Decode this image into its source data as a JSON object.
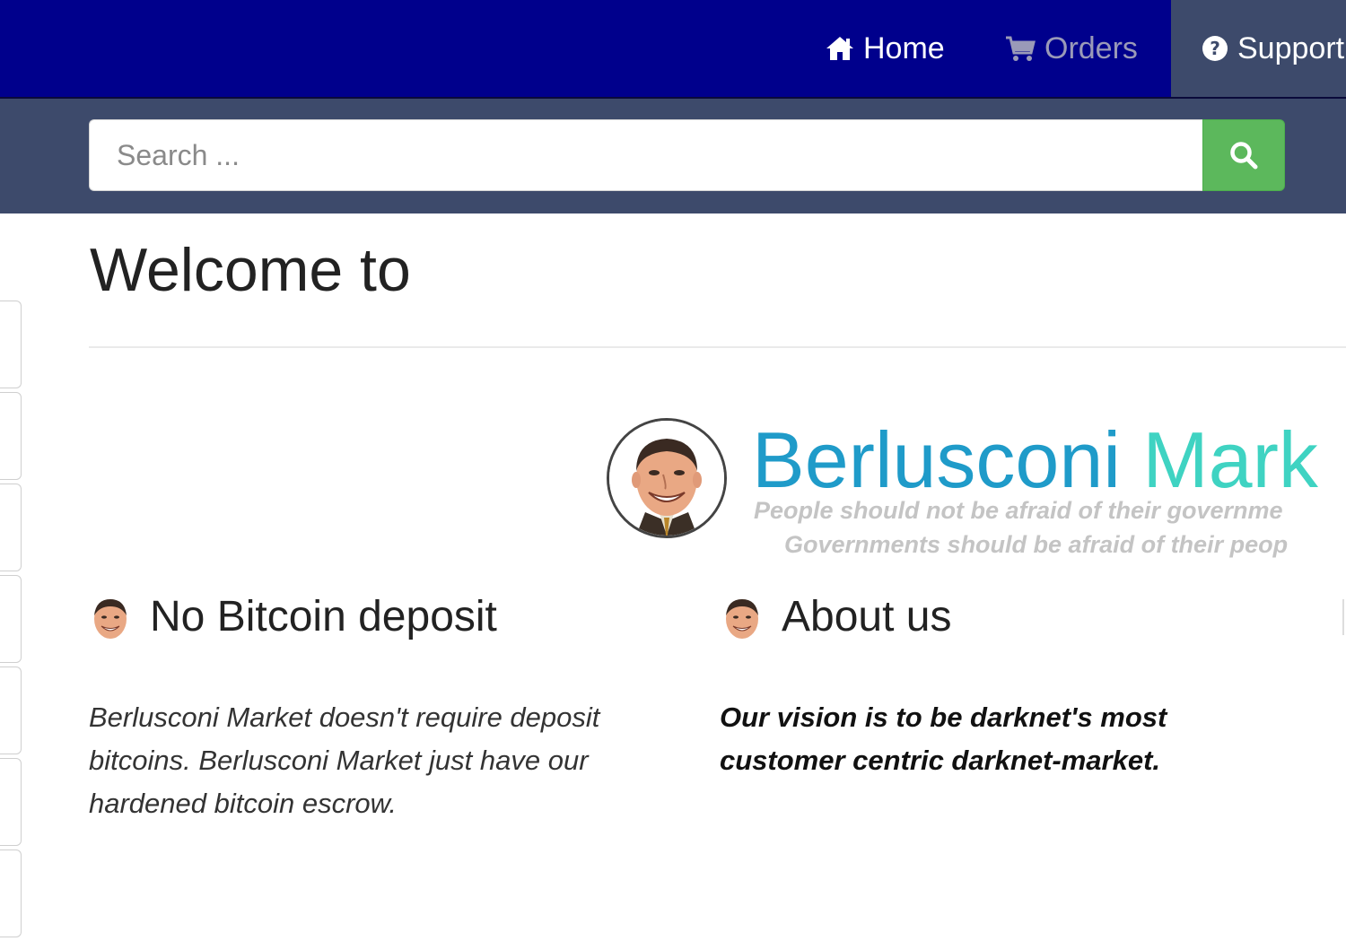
{
  "nav": {
    "home_label": "Home",
    "orders_label": "Orders",
    "support_label": "Support",
    "home_icon": "home-icon",
    "orders_icon": "cart-icon",
    "support_icon": "question-circle-icon",
    "background": "#00008c",
    "active_background": "#3d4a6b"
  },
  "search": {
    "placeholder": "Search ...",
    "value": "",
    "button_icon": "search-icon",
    "button_color": "#5cb85c"
  },
  "main": {
    "welcome_title": "Welcome to",
    "logo": {
      "name_part1": "Berlusconi",
      "name_part2": "Mark",
      "slogan_line1": "People should not be afraid of their governme",
      "slogan_line2": "Governments should be afraid of their peop"
    },
    "features": [
      {
        "title": "No Bitcoin deposit",
        "text": "Berlusconi Market doesn't require deposit bitcoins. Berlusconi Market just have our hardened bitcoin escrow."
      },
      {
        "title": "About us",
        "text": "Our vision is to be darknet's most customer centric darknet-market."
      }
    ]
  }
}
